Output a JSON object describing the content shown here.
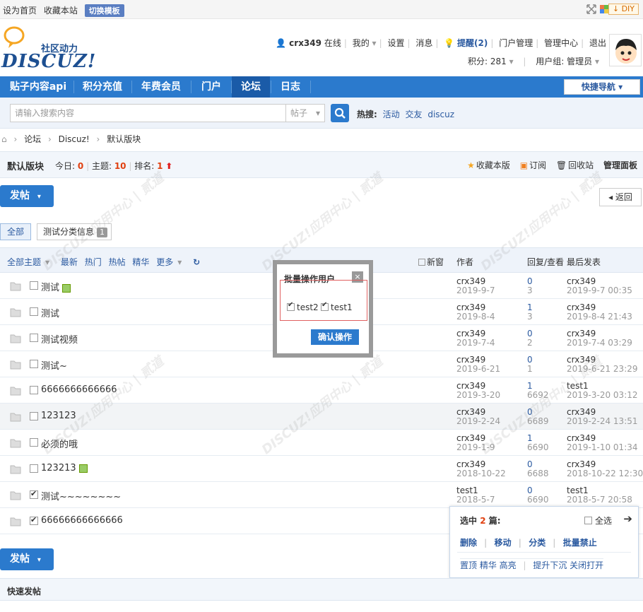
{
  "topbar": {
    "set_home": "设为首页",
    "favorite": "收藏本站",
    "switch_template": "切换模板",
    "diy": "DIY",
    "icons": [
      "fullscreen-icon",
      "style-icon"
    ]
  },
  "header": {
    "logo_sub": "社区动力",
    "logo_main": "DISCUZ!",
    "username": "crx349",
    "online": "在线",
    "links": [
      "我的",
      "设置",
      "消息",
      "提醒(2)",
      "门户管理",
      "管理中心",
      "退出"
    ],
    "points": "积分: 281",
    "usergroup": "用户组: 管理员"
  },
  "nav": {
    "items": [
      "贴子内容api",
      "积分充值",
      "年费会员",
      "门户",
      "论坛",
      "日志"
    ],
    "active": "论坛",
    "quick_nav": "快捷导航"
  },
  "search": {
    "placeholder": "请输入搜索内容",
    "type": "帖子",
    "hot_label": "热搜:",
    "hot": [
      "活动",
      "交友",
      "discuz"
    ]
  },
  "breadcrumb": [
    "论坛",
    "Discuz!",
    "默认版块"
  ],
  "forum": {
    "title": "默认版块",
    "today_label": "今日:",
    "today": "0",
    "threads_label": "主题:",
    "threads": "10",
    "rank_label": "排名:",
    "rank": "1",
    "fav": "收藏本版",
    "rss": "订阅",
    "recycle": "回收站",
    "manage": "管理面板"
  },
  "post_button": "发帖",
  "back": "返回",
  "tabs": {
    "all": "全部",
    "cat": "测试分类信息",
    "cat_count": "1"
  },
  "listhead": {
    "filters": [
      "全部主题",
      "最新",
      "热门",
      "热帖",
      "精华",
      "更多"
    ],
    "new_window": "新窗",
    "author": "作者",
    "replies": "回复/查看",
    "last": "最后发表"
  },
  "threads": [
    {
      "title": "测试",
      "attach": true,
      "checked": false,
      "author": "crx349",
      "date": "2019-9-7",
      "replies": "0",
      "views": "3",
      "last_user": "crx349",
      "last_time": "2019-9-7 00:35"
    },
    {
      "title": "测试",
      "attach": false,
      "checked": false,
      "author": "crx349",
      "date": "2019-8-4",
      "replies": "1",
      "views": "3",
      "last_user": "crx349",
      "last_time": "2019-8-4 21:43"
    },
    {
      "title": "测试视频",
      "attach": false,
      "checked": false,
      "author": "crx349",
      "date": "2019-7-4",
      "replies": "0",
      "views": "2",
      "last_user": "crx349",
      "last_time": "2019-7-4 03:29"
    },
    {
      "title": "测试~",
      "attach": false,
      "checked": false,
      "author": "crx349",
      "date": "2019-6-21",
      "replies": "0",
      "views": "1",
      "last_user": "crx349",
      "last_time": "2019-6-21 23:29"
    },
    {
      "title": "6666666666666",
      "attach": false,
      "checked": false,
      "author": "crx349",
      "date": "2019-3-20",
      "replies": "1",
      "views": "6692",
      "last_user": "test1",
      "last_time": "2019-3-20 03:12"
    },
    {
      "title": "123123",
      "attach": false,
      "checked": false,
      "author": "crx349",
      "date": "2019-2-24",
      "replies": "0",
      "views": "6689",
      "last_user": "crx349",
      "last_time": "2019-2-24 13:51"
    },
    {
      "title": "必须的哦",
      "attach": false,
      "checked": false,
      "author": "crx349",
      "date": "2019-1-9",
      "replies": "1",
      "views": "6690",
      "last_user": "crx349",
      "last_time": "2019-1-10 01:34"
    },
    {
      "title": "123213",
      "attach": true,
      "checked": false,
      "author": "crx349",
      "date": "2018-10-22",
      "replies": "0",
      "views": "6688",
      "last_user": "crx349",
      "last_time": "2018-10-22 12:30"
    },
    {
      "title": "测试~~~~~~~~",
      "attach": false,
      "checked": true,
      "author": "test1",
      "date": "2018-5-7",
      "replies": "0",
      "views": "6690",
      "last_user": "test1",
      "last_time": "2018-5-7 20:58"
    },
    {
      "title": "66666666666666",
      "attach": false,
      "checked": true,
      "author": "",
      "date": "",
      "replies": "",
      "views": "",
      "last_user": "",
      "last_time": ""
    }
  ],
  "modal": {
    "title": "批量操作用户",
    "close": "×",
    "options": [
      "test2",
      "test1"
    ],
    "confirm": "确认操作"
  },
  "selection": {
    "label_pre": "选中",
    "count": "2",
    "label_post": "篇:",
    "select_all": "全选",
    "actions": [
      "删除",
      "移动",
      "分类",
      "批量禁止"
    ],
    "actions2": "置顶 精华 高亮",
    "actions3": "提升下沉 关闭打开"
  },
  "quickpost": "快速发帖",
  "watermark": "DISCUZ!应用中心 | 贰道"
}
